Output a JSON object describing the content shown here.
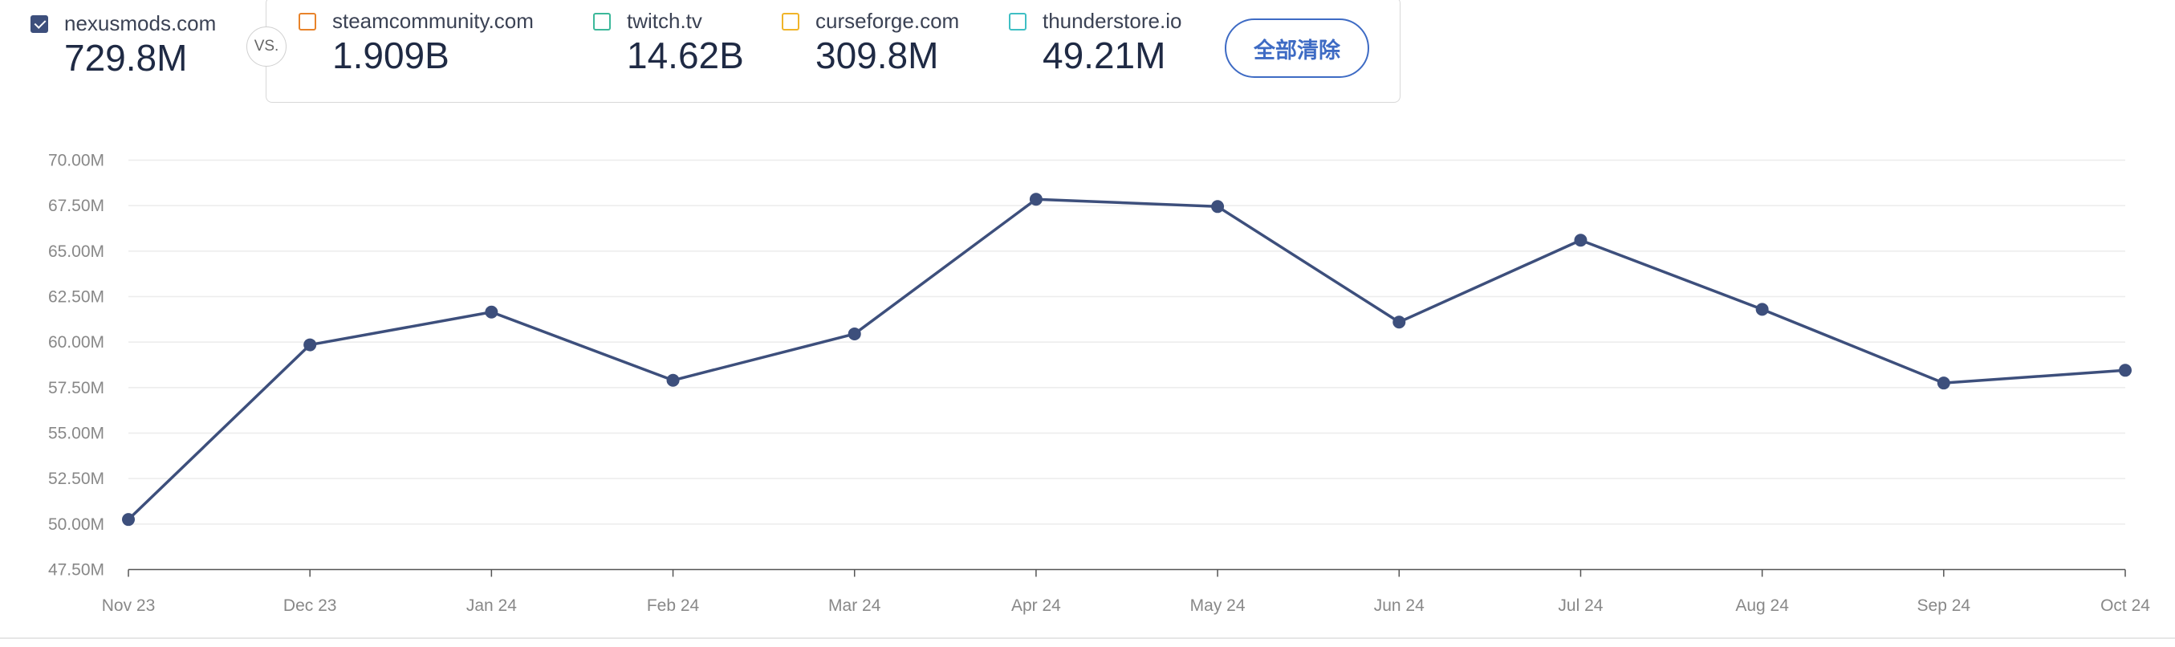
{
  "primary": {
    "site": "nexusmods.com",
    "value": "729.8M",
    "checked": true
  },
  "vs_label": "VS.",
  "comparisons": [
    {
      "site": "steamcommunity.com",
      "value": "1.909B",
      "color": "#e8832a"
    },
    {
      "site": "twitch.tv",
      "value": "14.62B",
      "color": "#3cb89a"
    },
    {
      "site": "curseforge.com",
      "value": "309.8M",
      "color": "#f0b429"
    },
    {
      "site": "thunderstore.io",
      "value": "49.21M",
      "color": "#3fbfc4"
    }
  ],
  "clear_button_label": "全部清除",
  "colors": {
    "line": "#3d4f7c",
    "accent": "#3e6bc4"
  },
  "chart_data": {
    "type": "line",
    "categories": [
      "Nov 23",
      "Dec 23",
      "Jan 24",
      "Feb 24",
      "Mar 24",
      "Apr 24",
      "May 24",
      "Jun 24",
      "Jul 24",
      "Aug 24",
      "Sep 24",
      "Oct 24"
    ],
    "series": [
      {
        "values": [
          50.25,
          59.85,
          61.65,
          57.9,
          60.45,
          67.85,
          67.45,
          61.1,
          65.6,
          61.8,
          57.75,
          58.45
        ]
      }
    ],
    "y_ticks": [
      "47.50M",
      "50.00M",
      "52.50M",
      "55.00M",
      "57.50M",
      "60.00M",
      "62.50M",
      "65.00M",
      "67.50M",
      "70.00M"
    ],
    "ylim": [
      47.5,
      70
    ],
    "grid": true
  }
}
